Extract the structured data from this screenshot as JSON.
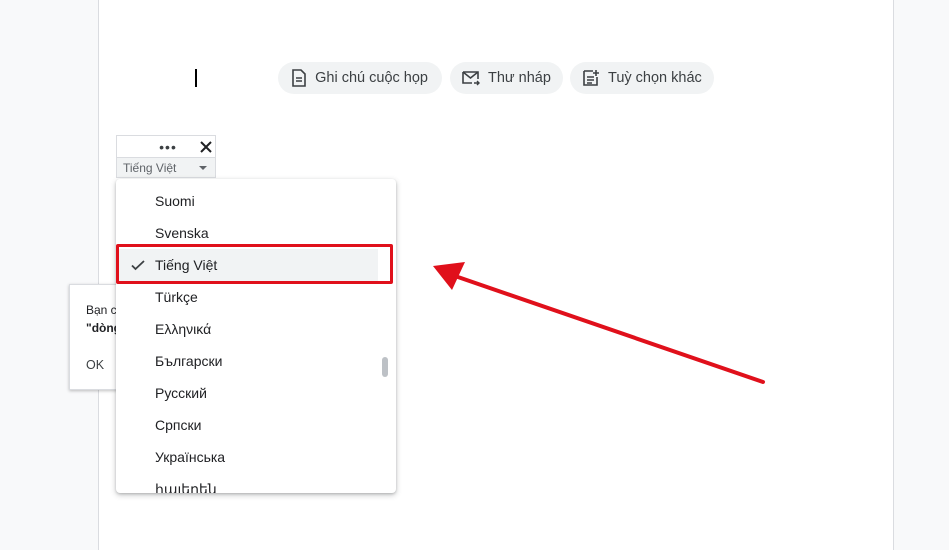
{
  "chips": [
    {
      "label": "Ghi chú cuộc họp",
      "icon": "document-icon"
    },
    {
      "label": "Thư nháp",
      "icon": "mail-draft-icon"
    },
    {
      "label": "Tuỳ chọn khác",
      "icon": "note-add-icon"
    }
  ],
  "mini_toolbar": {
    "more_icon": "more-horizontal-icon",
    "close_icon": "close-icon"
  },
  "language_select": {
    "value": "Tiếng Việt"
  },
  "dialog": {
    "line1": "Bạn c",
    "line2": "\"dòng",
    "ok": "OK"
  },
  "languages": [
    {
      "label": "Suomi",
      "selected": false
    },
    {
      "label": "Svenska",
      "selected": false
    },
    {
      "label": "Tiếng Việt",
      "selected": true
    },
    {
      "label": "Türkçe",
      "selected": false
    },
    {
      "label": "Ελληνικά",
      "selected": false
    },
    {
      "label": "Български",
      "selected": false
    },
    {
      "label": "Русский",
      "selected": false
    },
    {
      "label": "Српски",
      "selected": false
    },
    {
      "label": "Українська",
      "selected": false
    },
    {
      "label": "հայերեն",
      "selected": false
    }
  ],
  "colors": {
    "annotation": "#e0101b",
    "chip_bg": "#f1f3f4",
    "selected_bg": "#f1f3f4"
  }
}
